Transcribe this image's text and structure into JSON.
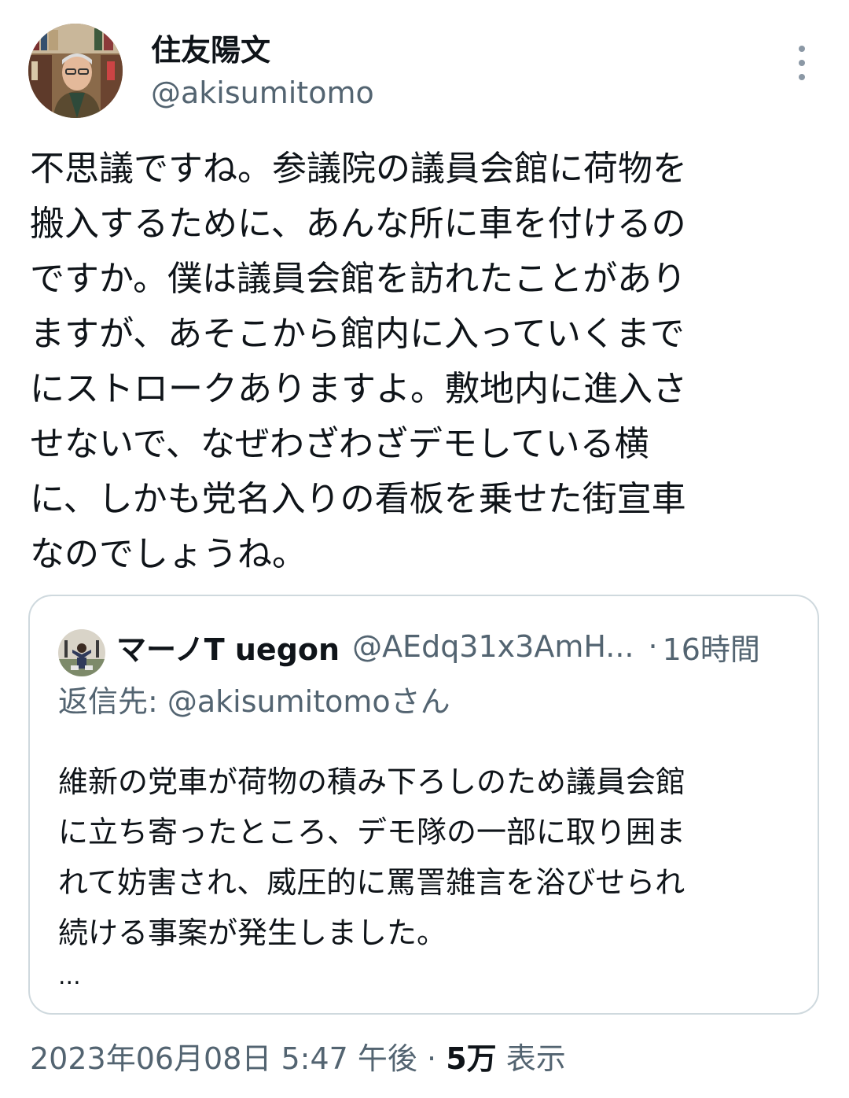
{
  "author": {
    "name": "住友陽文",
    "handle": "@akisumitomo"
  },
  "tweet": {
    "lines": [
      "不思議ですね。参議院の議員会館に荷物を",
      "搬入するために、あんな所に車を付けるの",
      "ですか。僕は議員会館を訪れたことがあり",
      "ますが、あそこから館内に入っていくまで",
      "にストロークありますよ。敷地内に進入さ",
      "せないで、なぜわざわざデモしている横",
      "に、しかも党名入りの看板を乗せた街宣車",
      "なのでしょうね。"
    ]
  },
  "quoted": {
    "name": "マーノT uegon",
    "handle": "@AEdq31x3AmH...",
    "separator": "·",
    "time": "16時間",
    "reply_to": "返信先: @akisumitomoさん",
    "lines": [
      "維新の党車が荷物の積み下ろしのため議員会館",
      "に立ち寄ったところ、デモ隊の一部に取り囲ま",
      "れて妨害され、威圧的に罵詈雑言を浴びせられ",
      "続ける事案が発生しました。"
    ],
    "ellipsis": "..."
  },
  "meta": {
    "date": "2023年06月08日 5:47 午後",
    "separator": "·",
    "views_count": "5万",
    "views_label": "表示"
  },
  "icons": {
    "more": "more-vertical-icon"
  },
  "colors": {
    "text": "#0f1419",
    "secondary": "#536471",
    "border": "#cfd9de"
  }
}
